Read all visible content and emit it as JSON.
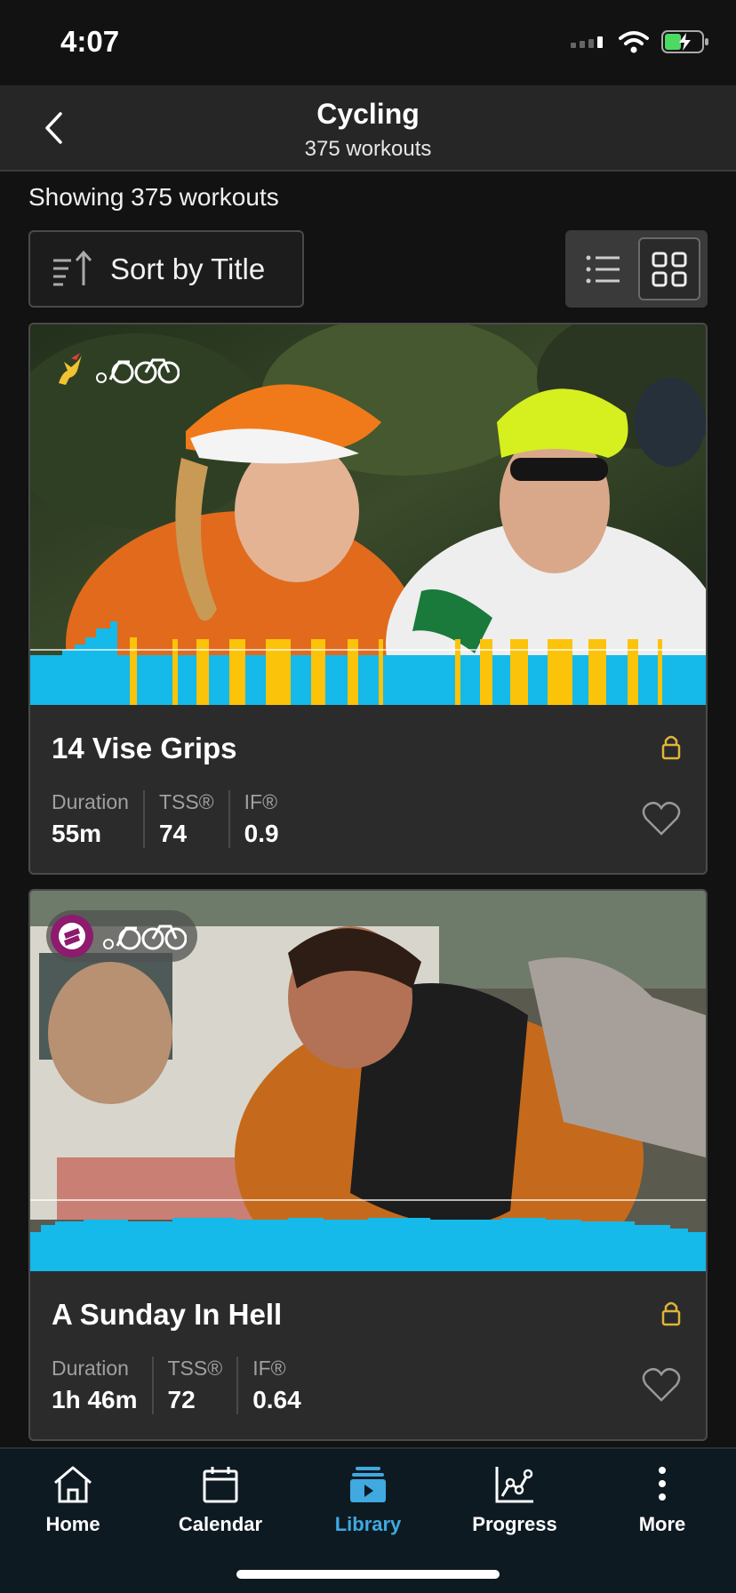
{
  "status": {
    "time": "4:07"
  },
  "header": {
    "title": "Cycling",
    "subtitle": "375 workouts"
  },
  "list": {
    "showing": "Showing 375 workouts"
  },
  "sort": {
    "label": "Sort by Title"
  },
  "workouts": [
    {
      "title": "14 Vise Grips",
      "duration_label": "Duration",
      "duration": "55m",
      "tss_label": "TSS®",
      "tss": "74",
      "if_label": "IF®",
      "if": "0.9"
    },
    {
      "title": "A Sunday In Hell",
      "duration_label": "Duration",
      "duration": "1h 46m",
      "tss_label": "TSS®",
      "tss": "72",
      "if_label": "IF®",
      "if": "0.64"
    }
  ],
  "tabs": [
    {
      "label": "Home",
      "icon": "home-icon"
    },
    {
      "label": "Calendar",
      "icon": "calendar-icon"
    },
    {
      "label": "Library",
      "icon": "library-icon"
    },
    {
      "label": "Progress",
      "icon": "progress-icon"
    },
    {
      "label": "More",
      "icon": "more-icon"
    }
  ],
  "colors": {
    "accent": "#3fa9e0",
    "lock": "#e0b43a",
    "profile_blue": "#15b9ea",
    "profile_yellow": "#fcc30b"
  }
}
